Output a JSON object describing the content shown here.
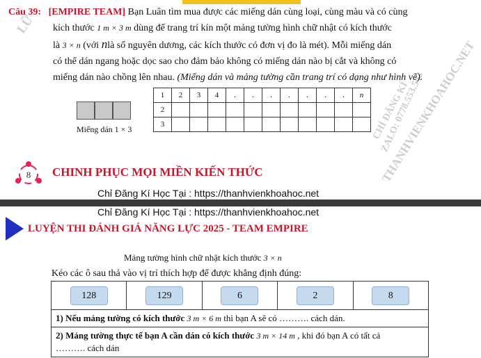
{
  "question": {
    "number": "Câu 39:",
    "team": "[EMPIRE TEAM]",
    "line1": "Bạn Luân tìm mua được các miếng dán cùng loại, cùng màu và có cùng",
    "line2a": "kích thước",
    "size1": "1 m × 3 m",
    "line2b": "dùng để trang trí kín một mảng tường hình chữ nhật có kích thước",
    "line3a": "là",
    "size2": "3 × n",
    "line3b": "(với",
    "n": "n",
    "line3c": "là số nguyên dương, các kích thước có đơn vị đo là mét). Mỗi miếng dán",
    "line4": "có thể dán ngang hoặc dọc sao cho đảm bảo không có miếng dán nào bị cắt và không có",
    "line5a": "miếng dán nào chồng lên nhau.",
    "line5b": "(Miếng dán và mảng tường cần trang trí có dạng như hình vẽ).",
    "tile_caption": "Miếng dán 1 × 3",
    "grid_header": [
      "1",
      "2",
      "3",
      "4",
      ".",
      ".",
      ".",
      ".",
      ".",
      ".",
      ".",
      "n"
    ],
    "grid_rows": [
      "2",
      "3"
    ]
  },
  "watermark": {
    "line1": "THANHVIENKHOAHOC.NET",
    "line2": "ZALO: 0778.553.543",
    "line3": "CHỈ ĐĂNG KÍ",
    "left": "LỮ"
  },
  "banner": {
    "icon_number": "8",
    "title": "CHINH PHỤC MỌI MIỀN KIẾN THỨC",
    "register1": "Chỉ Đăng Kí Học Tại : https://thanhvienkhoahoc.net",
    "register2": "Chỉ Đăng Kí Học Tại : https://thanhvienkhoahoc.net"
  },
  "section": {
    "title": "LUYỆN THI ĐÁNH GIÁ NĂNG LỰC 2025 - TEAM EMPIRE",
    "subtitle": "Mảng tường hình chữ nhật kích thước",
    "subtitle_math": "3 × n",
    "instruction": "Kéo các ô sau thả vào vị trí thích hợp để được khẳng định đúng:",
    "chips": [
      "128",
      "129",
      "6",
      "2",
      "8"
    ],
    "s1_a": "1) Nếu mảng tường có kích thước",
    "s1_math": "3 m × 6 m",
    "s1_b": "thì bạn A sẽ có ………. cách dán.",
    "s2_a": "2) Mảng tường thực tế bạn A cần dán có kích thước",
    "s2_math": "3 m × 14 m",
    "s2_b": ", khi đó bạn A có tất cả",
    "s2_c": "………. cách dán"
  },
  "colors": {
    "red": "#c8152c",
    "blue": "#1f2fbf",
    "chip": "#c5d9ef",
    "tile": "#c9c9c9"
  }
}
